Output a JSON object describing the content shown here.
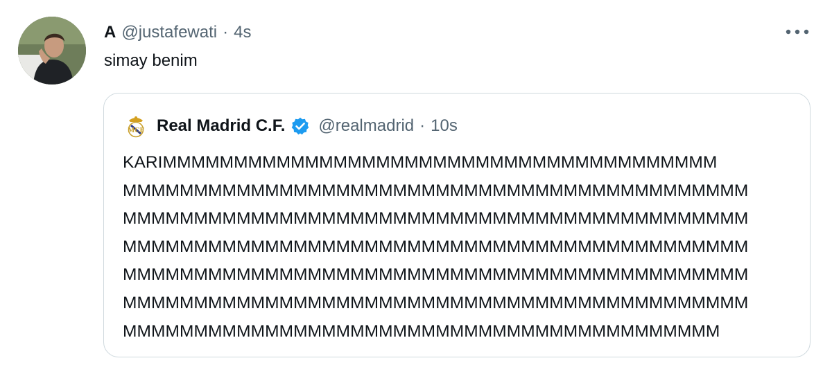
{
  "author": {
    "display_name": "A",
    "handle": "@justafewati",
    "separator": "·",
    "time": "4s"
  },
  "tweet": {
    "text": "simay benim"
  },
  "quoted": {
    "display_name": "Real Madrid C.F.",
    "handle": "@realmadrid",
    "separator": "·",
    "time": "10s",
    "verified_icon": "verified-badge-icon",
    "text_lines": [
      "KARIMMMMMMMMMMMMMMMMMMMMMMMMMMMMMMMMMMMMMMM",
      "MMMMMMMMMMMMMMMMMMMMMMMMMMMMMMMMMMMMMMMMMMMM",
      "MMMMMMMMMMMMMMMMMMMMMMMMMMMMMMMMMMMMMMMMMMMM",
      "MMMMMMMMMMMMMMMMMMMMMMMMMMMMMMMMMMMMMMMMMMMM",
      "MMMMMMMMMMMMMMMMMMMMMMMMMMMMMMMMMMMMMMMMMMMM",
      "MMMMMMMMMMMMMMMMMMMMMMMMMMMMMMMMMMMMMMMMMMMM",
      "MMMMMMMMMMMMMMMMMMMMMMMMMMMMMMMMMMMMMMMMMM"
    ]
  },
  "icons": {
    "more": "more-options-icon",
    "verified": "verified-badge-icon"
  },
  "colors": {
    "text": "#0f1419",
    "secondary": "#536471",
    "border": "#cfd9de",
    "verified": "#1d9bf0"
  }
}
